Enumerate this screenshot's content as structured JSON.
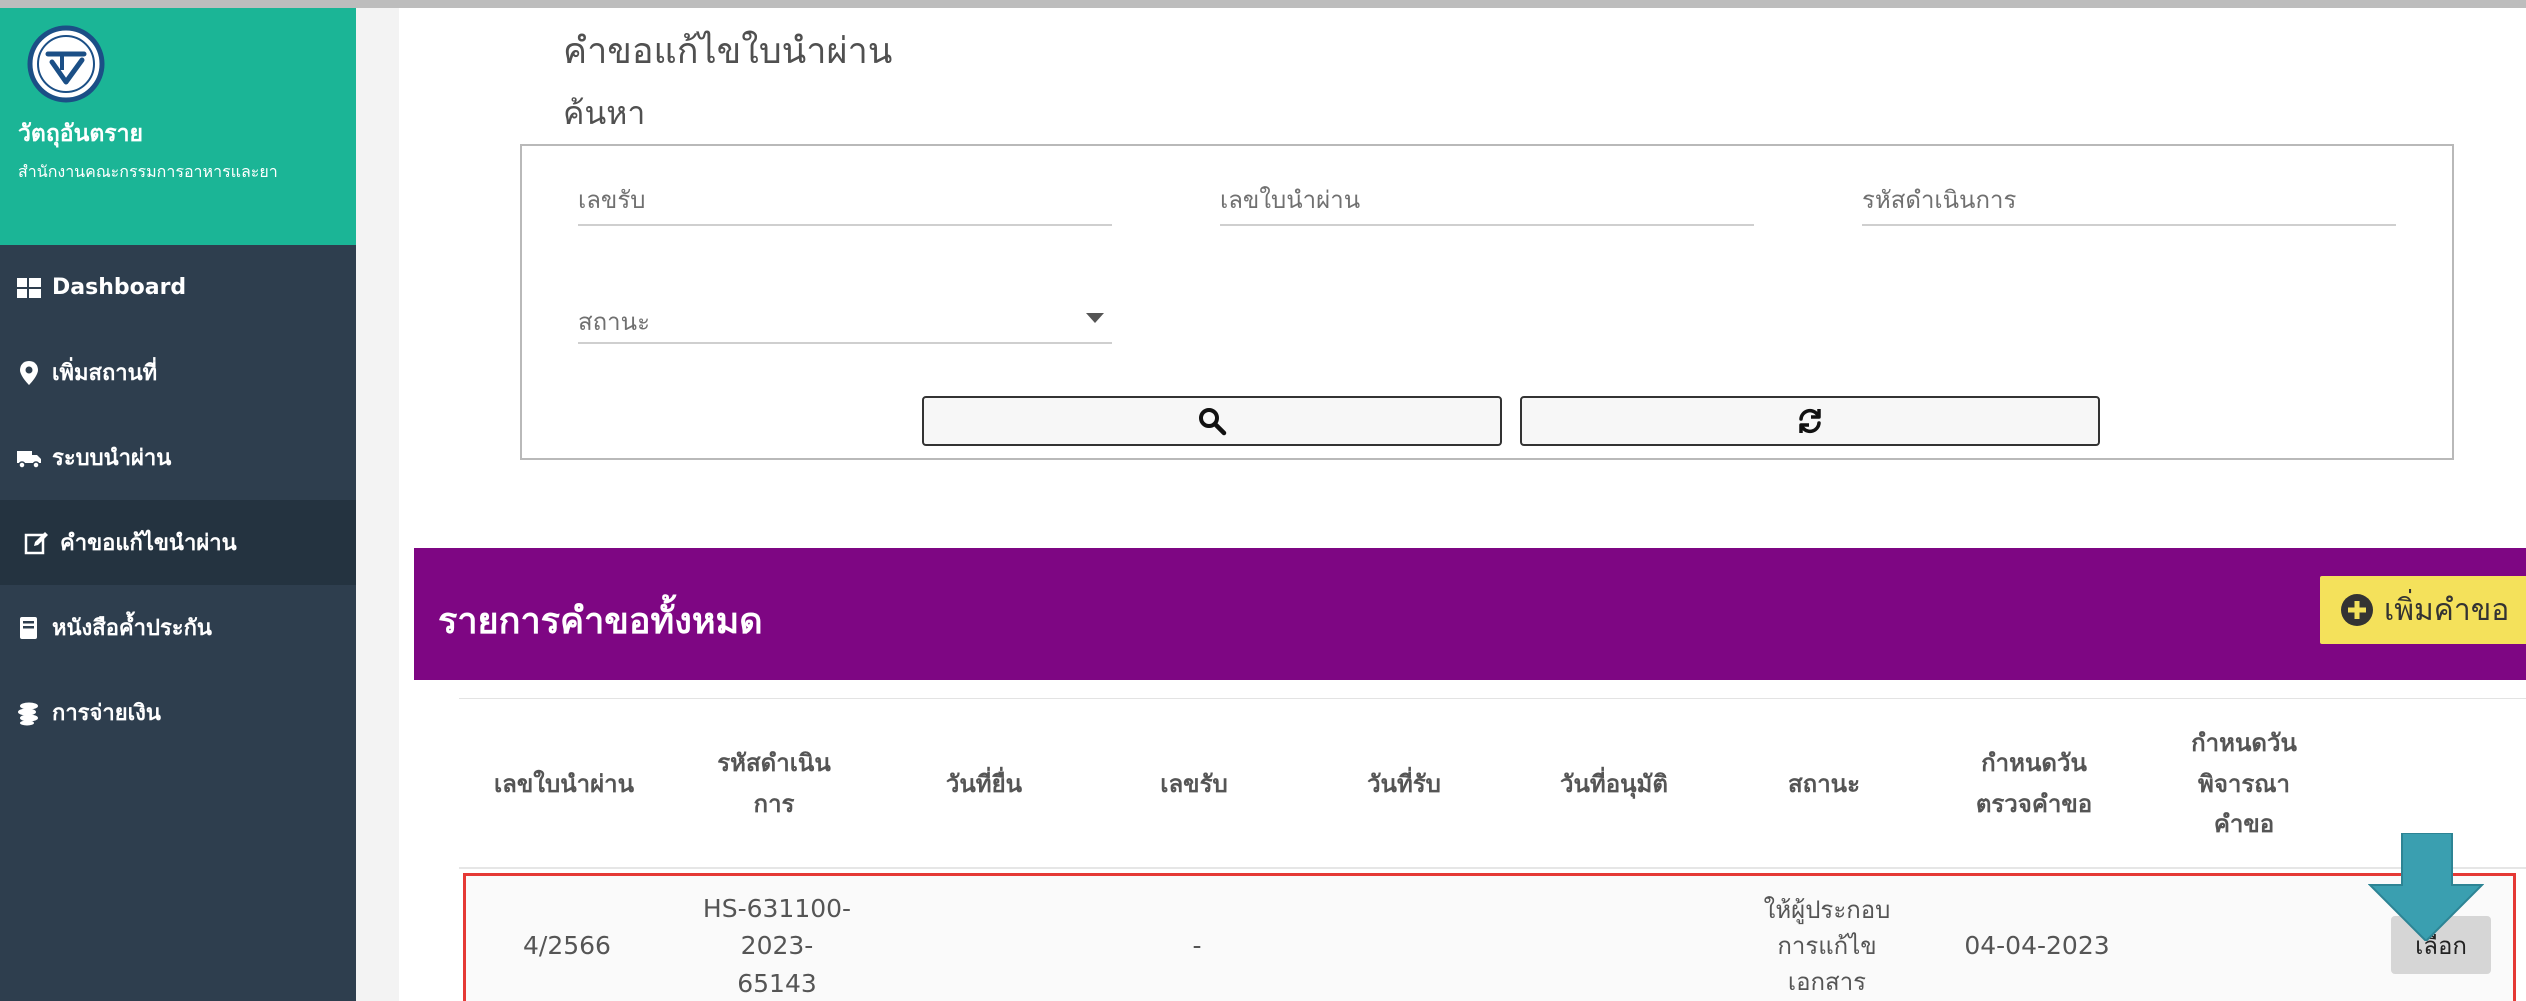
{
  "sidebar": {
    "brand_title": "วัตถุอันตราย",
    "brand_subtitle": "สำนักงานคณะกรรมการอาหารและยา",
    "items": [
      {
        "label": "Dashboard",
        "icon": "dashboard-icon"
      },
      {
        "label": "เพิ่มสถานที่",
        "icon": "map-marker-icon"
      },
      {
        "label": "ระบบนำผ่าน",
        "icon": "truck-icon"
      },
      {
        "label": "คำขอแก้ไขนำผ่าน",
        "icon": "edit-icon",
        "active": true
      },
      {
        "label": "หนังสือค้ำประกัน",
        "icon": "book-icon"
      },
      {
        "label": "การจ่ายเงิน",
        "icon": "coins-icon"
      }
    ]
  },
  "main": {
    "page_title": "คำขอแก้ไขใบนำผ่าน",
    "search_heading": "ค้นหา",
    "search": {
      "receipt_no_placeholder": "เลขรับ",
      "license_no_placeholder": "เลขใบนำผ่าน",
      "operation_code_placeholder": "รหัสดำเนินการ",
      "status_placeholder": "สถานะ",
      "search_icon": "search-icon",
      "reset_icon": "refresh-icon"
    },
    "list": {
      "title": "รายการคำขอทั้งหมด",
      "add_button_label": "เพิ่มคำขอ",
      "columns": [
        "เลขใบนำผ่าน",
        "รหัสดำเนินการ",
        "วันที่ยื่น",
        "เลขรับ",
        "วันที่รับ",
        "วันที่อนุมัติ",
        "สถานะ",
        "กำหนดวันตรวจคำขอ",
        "กำหนดวันพิจารณาคำขอ"
      ],
      "rows": [
        {
          "license_no": "4/2566",
          "operation_code": "HS-631100-2023-65143",
          "submit_date": "",
          "receipt_no": "-",
          "receive_date": "",
          "approve_date": "",
          "status": "ให้ผู้ประกอบการแก้ไขเอกสาร",
          "inspect_due": "04-04-2023",
          "consider_due": "",
          "select_label": "เลือก"
        }
      ]
    }
  },
  "colors": {
    "brand_green": "#1bb596",
    "sidebar_dark": "#2e3e4e",
    "list_header_purple": "#7e0683",
    "add_button_yellow": "#f4e15b",
    "highlight_red": "#e53935",
    "pointer_teal": "#3a9fb0"
  }
}
